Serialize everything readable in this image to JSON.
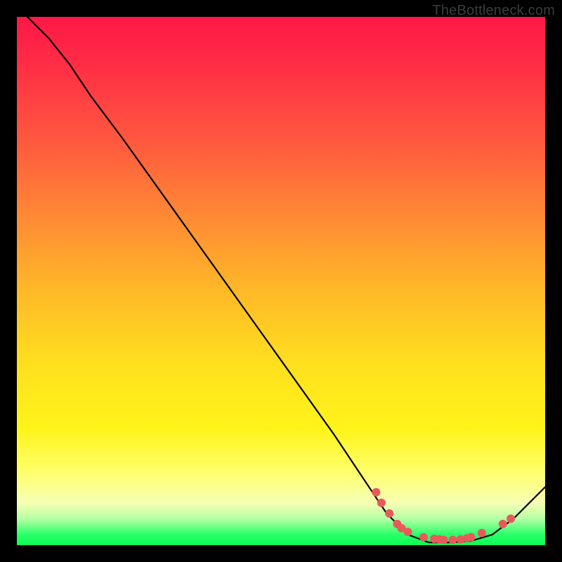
{
  "watermark": "TheBottleneck.com",
  "chart_data": {
    "type": "line",
    "title": "",
    "xlabel": "",
    "ylabel": "",
    "xlim": [
      0,
      100
    ],
    "ylim": [
      0,
      100
    ],
    "series": [
      {
        "name": "bottleneck-curve",
        "points": [
          {
            "x": 2,
            "y": 100
          },
          {
            "x": 6,
            "y": 96
          },
          {
            "x": 10,
            "y": 91
          },
          {
            "x": 14,
            "y": 85
          },
          {
            "x": 20,
            "y": 77
          },
          {
            "x": 30,
            "y": 63
          },
          {
            "x": 40,
            "y": 49
          },
          {
            "x": 50,
            "y": 35
          },
          {
            "x": 60,
            "y": 21
          },
          {
            "x": 66,
            "y": 12
          },
          {
            "x": 70,
            "y": 6
          },
          {
            "x": 74,
            "y": 2
          },
          {
            "x": 78,
            "y": 0.5
          },
          {
            "x": 82,
            "y": 0.5
          },
          {
            "x": 86,
            "y": 0.8
          },
          {
            "x": 90,
            "y": 2
          },
          {
            "x": 94,
            "y": 5
          },
          {
            "x": 98,
            "y": 9
          },
          {
            "x": 100,
            "y": 11
          }
        ]
      },
      {
        "name": "highlight-dots",
        "points": [
          {
            "x": 68,
            "y": 10
          },
          {
            "x": 69,
            "y": 8
          },
          {
            "x": 70.5,
            "y": 6
          },
          {
            "x": 72,
            "y": 4
          },
          {
            "x": 72.8,
            "y": 3.2
          },
          {
            "x": 74,
            "y": 2.5
          },
          {
            "x": 77,
            "y": 1.5
          },
          {
            "x": 79,
            "y": 1.2
          },
          {
            "x": 80,
            "y": 1.1
          },
          {
            "x": 80.8,
            "y": 1.0
          },
          {
            "x": 82.5,
            "y": 1.0
          },
          {
            "x": 84,
            "y": 1.1
          },
          {
            "x": 85.2,
            "y": 1.3
          },
          {
            "x": 86,
            "y": 1.5
          },
          {
            "x": 88,
            "y": 2.3
          },
          {
            "x": 92,
            "y": 4.0
          },
          {
            "x": 93.5,
            "y": 5.0
          }
        ]
      }
    ],
    "gradient_stops": [
      {
        "pos": 0.0,
        "color": "#ff1846"
      },
      {
        "pos": 0.24,
        "color": "#ff5a3e"
      },
      {
        "pos": 0.52,
        "color": "#ffb928"
      },
      {
        "pos": 0.78,
        "color": "#fff41a"
      },
      {
        "pos": 0.92,
        "color": "#f6ffb4"
      },
      {
        "pos": 1.0,
        "color": "#0aff52"
      }
    ]
  }
}
